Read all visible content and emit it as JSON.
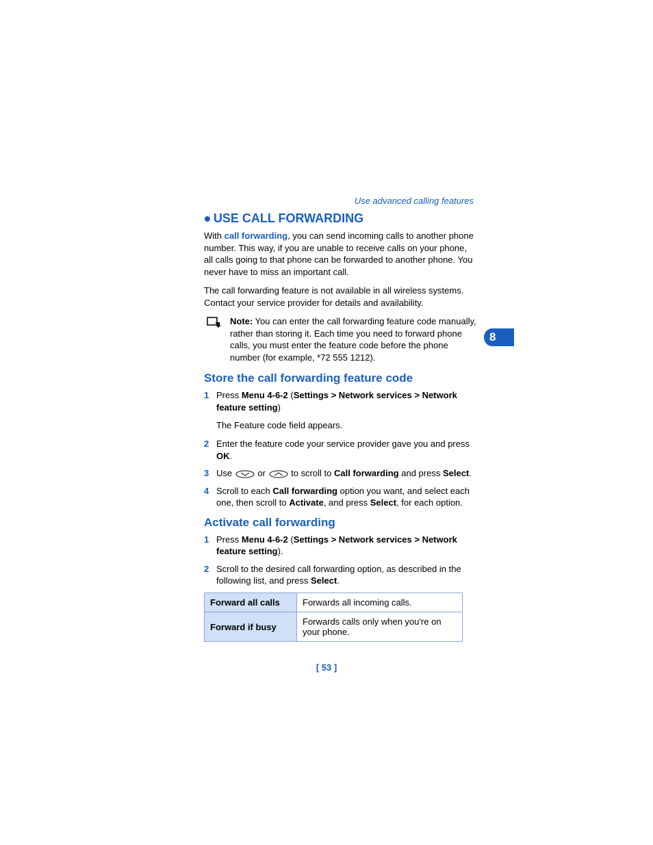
{
  "header": {
    "link": "Use advanced calling features"
  },
  "chapter": {
    "number": "8"
  },
  "section": {
    "title": "USE CALL FORWARDING",
    "intro_prefix": "With ",
    "intro_link": "call forwarding",
    "intro_suffix": ", you can send incoming calls to another phone number. This way, if you are unable to receive calls on your phone, all calls going to that phone can be forwarded to another phone. You never have to miss an important call.",
    "availability": "The call forwarding feature is not available in all wireless systems. Contact your service provider for details and availability."
  },
  "note": {
    "label": "Note:",
    "text": " You can enter the call forwarding feature code manually, rather than storing it. Each time you need to forward phone calls, you must enter the feature code before the phone number (for example, *72 555 1212)."
  },
  "store": {
    "title": "Store the call forwarding feature code",
    "steps": {
      "s1a": "Press ",
      "s1b": "Menu 4-6-2",
      "s1c": " (",
      "s1d": "Settings > Network services > Network feature setting",
      "s1e": ")",
      "s1_sub": "The Feature code field appears.",
      "s2a": "Enter the feature code your service provider gave you and press ",
      "s2b": "OK",
      "s2c": ".",
      "s3a": "Use ",
      "s3b": " or ",
      "s3c": " to scroll to ",
      "s3d": "Call forwarding",
      "s3e": " and press ",
      "s3f": "Select",
      "s3g": ".",
      "s4a": "Scroll to each ",
      "s4b": "Call forwarding",
      "s4c": " option you want, and select each one, then scroll to ",
      "s4d": "Activate",
      "s4e": ", and press ",
      "s4f": "Select",
      "s4g": ", for each option."
    }
  },
  "activate": {
    "title": "Activate call forwarding",
    "steps": {
      "s1a": "Press ",
      "s1b": "Menu 4-6-2",
      "s1c": " (",
      "s1d": "Settings > Network services > Network feature setting",
      "s1e": ").",
      "s2a": "Scroll to the desired call forwarding option, as described in the following list, and press ",
      "s2b": "Select",
      "s2c": "."
    }
  },
  "table": {
    "rows": [
      {
        "label": "Forward all calls",
        "desc": "Forwards all incoming calls."
      },
      {
        "label": "Forward if busy",
        "desc": "Forwards calls only when you're on your phone."
      }
    ]
  },
  "footer": {
    "page": "[ 53 ]"
  }
}
